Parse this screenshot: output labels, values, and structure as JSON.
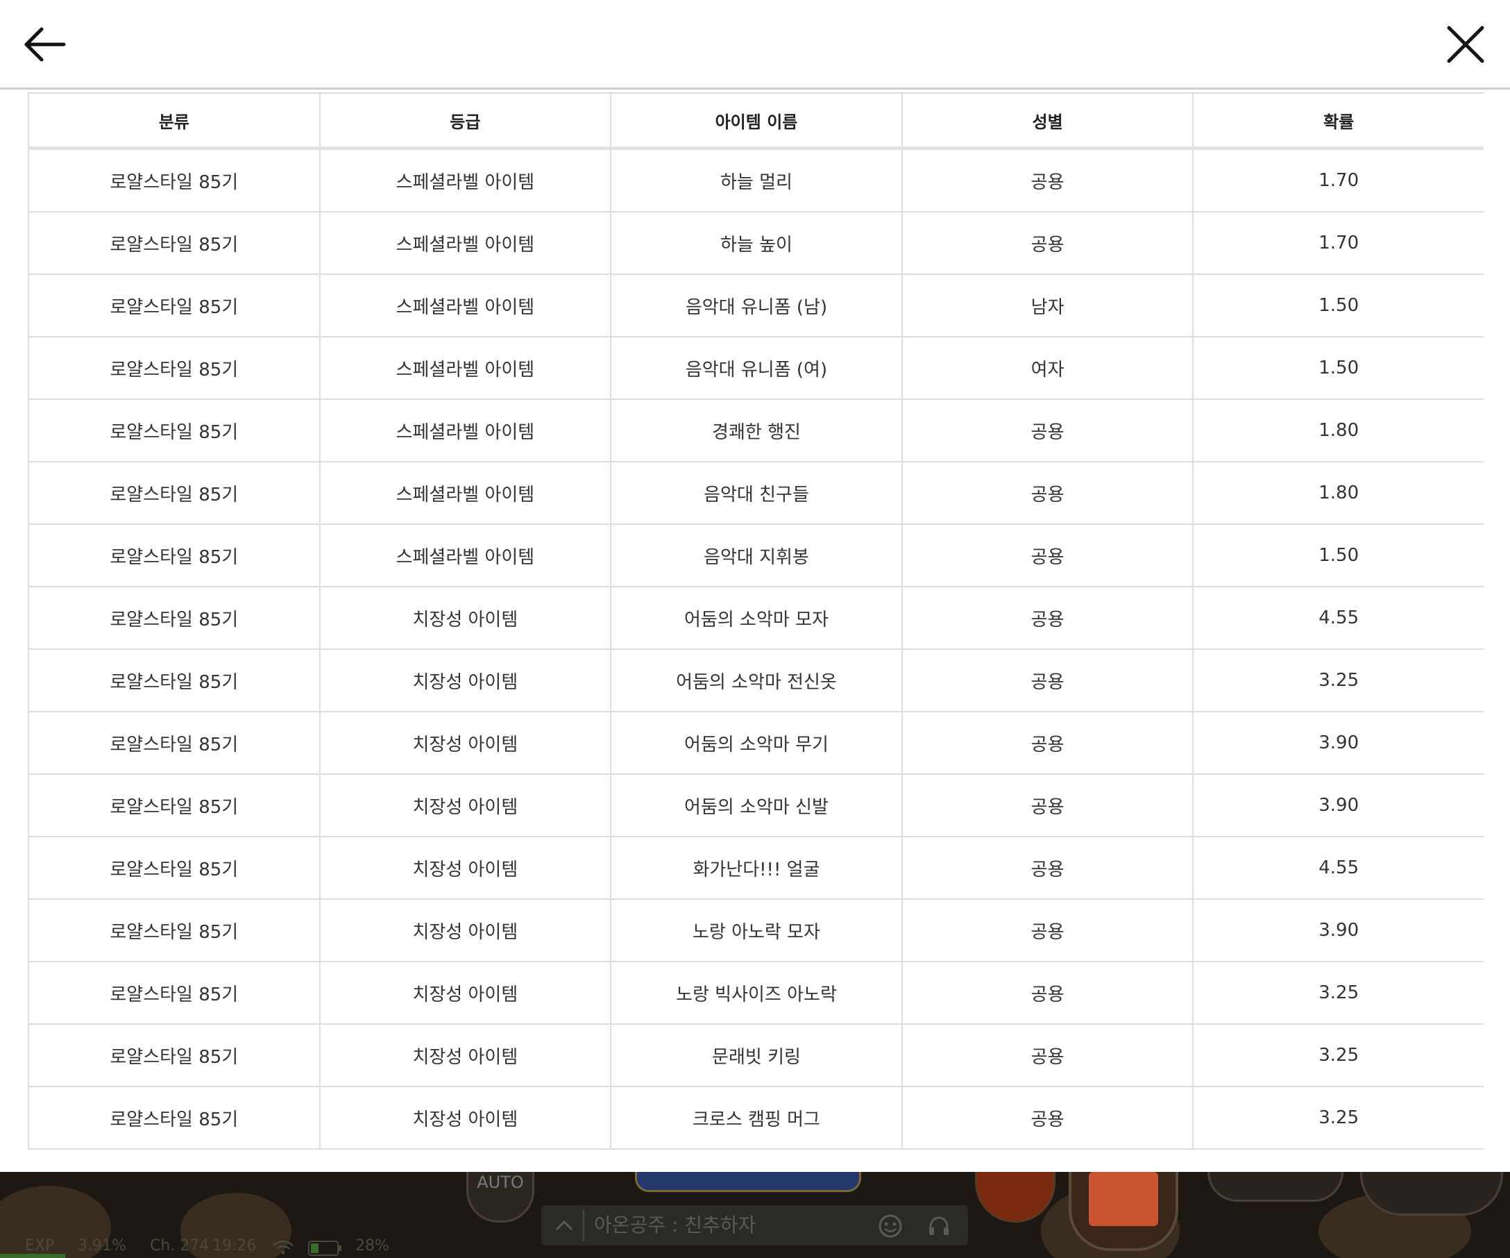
{
  "header": {
    "back_icon": "arrow-left-icon",
    "close_icon": "close-icon"
  },
  "table": {
    "columns": [
      "분류",
      "등급",
      "아이템 이름",
      "성별",
      "확률"
    ],
    "rows": [
      [
        "로얄스타일 85기",
        "스페셜라벨 아이템",
        "하늘 멀리",
        "공용",
        "1.70"
      ],
      [
        "로얄스타일 85기",
        "스페셜라벨 아이템",
        "하늘 높이",
        "공용",
        "1.70"
      ],
      [
        "로얄스타일 85기",
        "스페셜라벨 아이템",
        "음악대 유니폼 (남)",
        "남자",
        "1.50"
      ],
      [
        "로얄스타일 85기",
        "스페셜라벨 아이템",
        "음악대 유니폼 (여)",
        "여자",
        "1.50"
      ],
      [
        "로얄스타일 85기",
        "스페셜라벨 아이템",
        "경쾌한 행진",
        "공용",
        "1.80"
      ],
      [
        "로얄스타일 85기",
        "스페셜라벨 아이템",
        "음악대 친구들",
        "공용",
        "1.80"
      ],
      [
        "로얄스타일 85기",
        "스페셜라벨 아이템",
        "음악대 지휘봉",
        "공용",
        "1.50"
      ],
      [
        "로얄스타일 85기",
        "치장성 아이템",
        "어둠의 소악마 모자",
        "공용",
        "4.55"
      ],
      [
        "로얄스타일 85기",
        "치장성 아이템",
        "어둠의 소악마 전신옷",
        "공용",
        "3.25"
      ],
      [
        "로얄스타일 85기",
        "치장성 아이템",
        "어둠의 소악마 무기",
        "공용",
        "3.90"
      ],
      [
        "로얄스타일 85기",
        "치장성 아이템",
        "어둠의 소악마 신발",
        "공용",
        "3.90"
      ],
      [
        "로얄스타일 85기",
        "치장성 아이템",
        "화가난다!!! 얼굴",
        "공용",
        "4.55"
      ],
      [
        "로얄스타일 85기",
        "치장성 아이템",
        "노랑 아노락 모자",
        "공용",
        "3.90"
      ],
      [
        "로얄스타일 85기",
        "치장성 아이템",
        "노랑 빅사이즈 아노락",
        "공용",
        "3.25"
      ],
      [
        "로얄스타일 85기",
        "치장성 아이템",
        "문래빗 키링",
        "공용",
        "3.25"
      ],
      [
        "로얄스타일 85기",
        "치장성 아이템",
        "크로스 캠핑 머그",
        "공용",
        "3.25"
      ]
    ]
  },
  "game": {
    "auto_label": "AUTO",
    "chat_text": "아온공주 : 친추하자",
    "status": {
      "exp_label": "EXP",
      "exp_percent": "3.91%",
      "channel": "Ch. 274",
      "time": "19:26",
      "battery": "28%"
    },
    "chat_icons": [
      "emoji-icon",
      "headset-icon"
    ]
  }
}
